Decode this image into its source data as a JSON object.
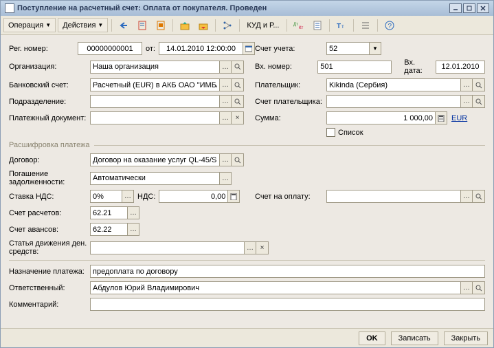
{
  "window": {
    "title": "Поступление на расчетный счет: Оплата от покупателя. Проведен"
  },
  "toolbar": {
    "operation": "Операция",
    "actions": "Действия",
    "kud": "КУД и Р..."
  },
  "labels": {
    "reg_number": "Рег. номер:",
    "ot": "от:",
    "org": "Организация:",
    "bank_acct": "Банковский счет:",
    "subdiv": "Подразделение:",
    "pay_doc": "Платежный документ:",
    "uchet": "Счет учета:",
    "vh_nomer": "Вх. номер:",
    "vh_data": "Вх. дата:",
    "payer": "Плательщик:",
    "payer_acct": "Счет плательщика:",
    "summa": "Сумма:",
    "spisok": "Список",
    "section": "Расшифровка платежа",
    "contract": "Договор:",
    "pogashenie": "Погашение задолженности:",
    "vat_rate": "Ставка НДС:",
    "vat": "НДС:",
    "invoice": "Счет на оплату:",
    "acct_settlement": "Счет расчетов:",
    "acct_advance": "Счет авансов:",
    "cashflow": "Статья движения ден. средств:",
    "purpose": "Назначение платежа:",
    "responsible": "Ответственный:",
    "comment": "Комментарий:"
  },
  "values": {
    "reg_number": "00000000001",
    "datetime": "14.01.2010 12:00:00",
    "org": "Наша организация",
    "bank_acct": "Расчетный (EUR) в АКБ ОАО \"ИМБА",
    "subdiv": "",
    "pay_doc": "",
    "uchet": "52",
    "vh_nomer": "501",
    "vh_data": "12.01.2010",
    "payer": "Kikinda (Сербия)",
    "payer_acct": "",
    "summa": "1 000,00",
    "currency": "EUR",
    "contract": "Договор на оказание услуг QL-45/S",
    "pogashenie": "Автоматически",
    "vat_rate": "0%",
    "vat_amount": "0,00",
    "invoice": "",
    "acct_settlement": "62.21",
    "acct_advance": "62.22",
    "cashflow": "",
    "purpose": "предоплата по договору",
    "responsible": "Абдулов Юрий Владимирович",
    "comment": ""
  },
  "footer": {
    "ok": "OK",
    "save": "Записать",
    "close": "Закрыть"
  }
}
